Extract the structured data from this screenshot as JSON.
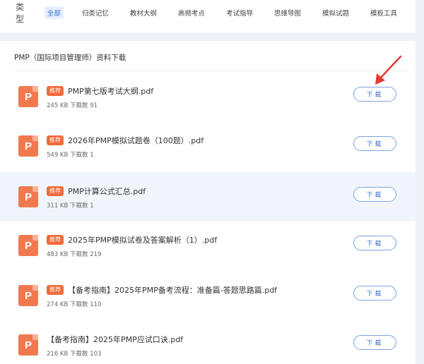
{
  "filter": {
    "label": "类型",
    "items": [
      {
        "label": "全部",
        "active": true
      },
      {
        "label": "归类记忆"
      },
      {
        "label": "教材大纲"
      },
      {
        "label": "高频考点"
      },
      {
        "label": "考试指导"
      },
      {
        "label": "思维导图"
      },
      {
        "label": "模拟试题"
      },
      {
        "label": "模板工具"
      }
    ]
  },
  "section": {
    "title": "PMP（国际项目管理师）资料下载"
  },
  "download_label": "下载",
  "badge_label": "推荐",
  "icon_letter": "P",
  "files": [
    {
      "name": "PMP第七版考试大纲.pdf",
      "meta": "245 KB 下载数 91",
      "recommended": true
    },
    {
      "name": "2026年PMP模拟试题卷（100题）.pdf",
      "meta": "549 KB 下载数 1",
      "recommended": true
    },
    {
      "name": "PMP计算公式汇总.pdf",
      "meta": "311 KB 下载数 1",
      "recommended": true,
      "highlighted": true
    },
    {
      "name": "2025年PMP模拟试卷及答案解析（1）.pdf",
      "meta": "483 KB 下载数 219",
      "recommended": true
    },
    {
      "name": "【备考指南】2025年PMP备考流程：准备篇-答题思路篇.pdf",
      "meta": "274 KB 下载数 110",
      "recommended": true
    },
    {
      "name": "【备考指南】2025年PMP应试口诀.pdf",
      "meta": "216 KB 下载数 103",
      "recommended": false
    }
  ],
  "colors": {
    "accent": "#2f6fd6",
    "badge": "#f26a3a",
    "file_icon": "#f07a4f",
    "arrow": "#e53935"
  }
}
